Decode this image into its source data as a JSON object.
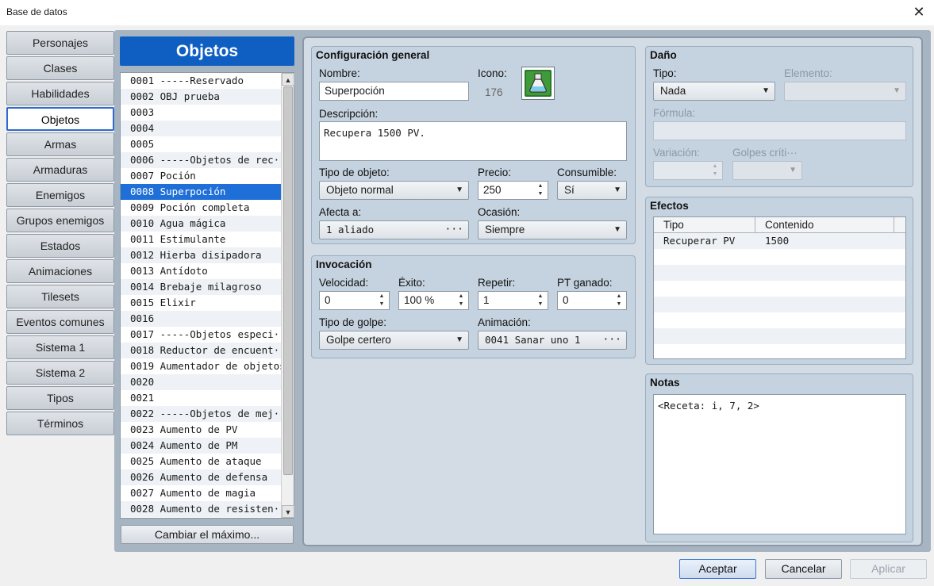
{
  "window": {
    "title": "Base de datos",
    "close_glyph": "✕"
  },
  "tabs": [
    {
      "label": "Personajes",
      "active": false
    },
    {
      "label": "Clases",
      "active": false
    },
    {
      "label": "Habilidades",
      "active": false
    },
    {
      "label": "Objetos",
      "active": true
    },
    {
      "label": "Armas",
      "active": false
    },
    {
      "label": "Armaduras",
      "active": false
    },
    {
      "label": "Enemigos",
      "active": false
    },
    {
      "label": "Grupos enemigos",
      "active": false
    },
    {
      "label": "Estados",
      "active": false
    },
    {
      "label": "Animaciones",
      "active": false
    },
    {
      "label": "Tilesets",
      "active": false
    },
    {
      "label": "Eventos comunes",
      "active": false
    },
    {
      "label": "Sistema 1",
      "active": false
    },
    {
      "label": "Sistema 2",
      "active": false
    },
    {
      "label": "Tipos",
      "active": false
    },
    {
      "label": "Términos",
      "active": false
    }
  ],
  "objects": {
    "header": "Objetos",
    "selected_index": 7,
    "items": [
      "0001 -----Reservado",
      "0002 OBJ prueba",
      "0003",
      "0004",
      "0005",
      "0006 -----Objetos de rec···",
      "0007 Poción",
      "0008 Superpoción",
      "0009 Poción completa",
      "0010 Agua mágica",
      "0011 Estimulante",
      "0012 Hierba disipadora",
      "0013 Antídoto",
      "0014 Brebaje milagroso",
      "0015 Elixir",
      "0016",
      "0017 -----Objetos especi···",
      "0018 Reductor de encuent···",
      "0019 Aumentador de objetos",
      "0020",
      "0021",
      "0022 -----Objetos de mej···",
      "0023 Aumento de PV",
      "0024 Aumento de PM",
      "0025 Aumento de ataque",
      "0026 Aumento de defensa",
      "0027 Aumento de magia",
      "0028 Aumento de resisten···"
    ],
    "change_max_label": "Cambiar el máximo..."
  },
  "general": {
    "title": "Configuración general",
    "name_label": "Nombre:",
    "name_value": "Superpoción",
    "icon_label": "Icono:",
    "icon_index": "176",
    "icon_name": "potion-icon",
    "desc_label": "Descripción:",
    "desc_value": "Recupera 1500 PV.",
    "type_label": "Tipo de objeto:",
    "type_value": "Objeto normal",
    "price_label": "Precio:",
    "price_value": "250",
    "consumable_label": "Consumible:",
    "consumable_value": "Sí",
    "scope_label": "Afecta a:",
    "scope_value": "1 aliado",
    "occasion_label": "Ocasión:",
    "occasion_value": "Siempre"
  },
  "invocation": {
    "title": "Invocación",
    "speed_label": "Velocidad:",
    "speed_value": "0",
    "success_label": "Éxito:",
    "success_value": "100 %",
    "repeat_label": "Repetir:",
    "repeat_value": "1",
    "tp_label": "PT ganado:",
    "tp_value": "0",
    "hit_label": "Tipo de golpe:",
    "hit_value": "Golpe certero",
    "anim_label": "Animación:",
    "anim_value": "0041 Sanar uno 1"
  },
  "damage": {
    "title": "Daño",
    "type_label": "Tipo:",
    "type_value": "Nada",
    "element_label": "Elemento:",
    "formula_label": "Fórmula:",
    "variance_label": "Variación:",
    "critical_label": "Golpes críti···"
  },
  "effects": {
    "title": "Efectos",
    "columns": [
      "Tipo",
      "Contenido"
    ],
    "rows": [
      [
        "Recuperar PV",
        "1500"
      ]
    ]
  },
  "notes": {
    "title": "Notas",
    "value": "<Receta: i, 7, 2>"
  },
  "buttons": {
    "ok": "Aceptar",
    "cancel": "Cancelar",
    "apply": "Aplicar"
  },
  "colors": {
    "accent": "#1f6fd8",
    "header_blue": "#0f5fc2",
    "workspace": "#a7b5c3"
  }
}
